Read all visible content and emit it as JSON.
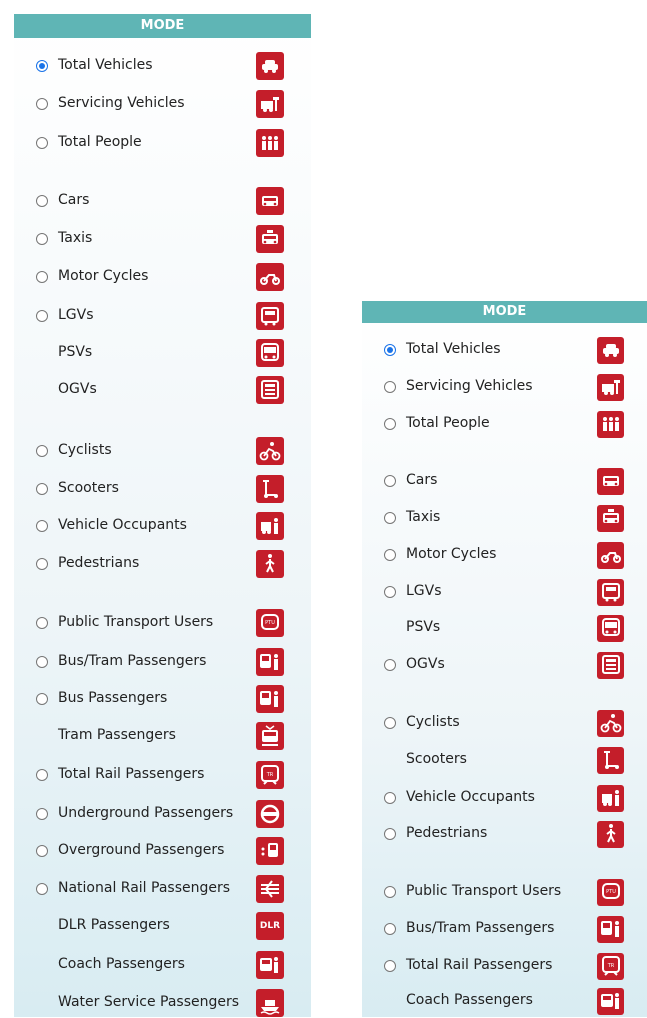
{
  "header": "MODE",
  "left_panel": {
    "items": [
      {
        "label": "Total Vehicles",
        "radio": true,
        "checked": true,
        "icon": "total-vehicles-icon"
      },
      {
        "label": "Servicing Vehicles",
        "radio": true,
        "checked": false,
        "icon": "servicing-vehicles-icon"
      },
      {
        "label": "Total People",
        "radio": true,
        "checked": false,
        "icon": "total-people-icon"
      },
      {
        "label": "Cars",
        "radio": true,
        "checked": false,
        "icon": "car-icon"
      },
      {
        "label": "Taxis",
        "radio": true,
        "checked": false,
        "icon": "taxi-icon"
      },
      {
        "label": "Motor Cycles",
        "radio": true,
        "checked": false,
        "icon": "motorcycle-icon"
      },
      {
        "label": "LGVs",
        "radio": true,
        "checked": false,
        "icon": "lgv-icon"
      },
      {
        "label": "PSVs",
        "radio": false,
        "checked": false,
        "icon": "psv-icon"
      },
      {
        "label": "OGVs",
        "radio": false,
        "checked": false,
        "icon": "ogv-icon"
      },
      {
        "label": "Cyclists",
        "radio": true,
        "checked": false,
        "icon": "cyclist-icon"
      },
      {
        "label": "Scooters",
        "radio": true,
        "checked": false,
        "icon": "scooter-icon"
      },
      {
        "label": "Vehicle Occupants",
        "radio": true,
        "checked": false,
        "icon": "vehicle-occupants-icon"
      },
      {
        "label": "Pedestrians",
        "radio": true,
        "checked": false,
        "icon": "pedestrian-icon"
      },
      {
        "label": "Public Transport Users",
        "radio": true,
        "checked": false,
        "icon": "ptu-icon"
      },
      {
        "label": "Bus/Tram Passengers",
        "radio": true,
        "checked": false,
        "icon": "bus-tram-passengers-icon"
      },
      {
        "label": "Bus Passengers",
        "radio": true,
        "checked": false,
        "icon": "bus-passengers-icon"
      },
      {
        "label": "Tram Passengers",
        "radio": false,
        "checked": false,
        "icon": "tram-passengers-icon"
      },
      {
        "label": "Total Rail Passengers",
        "radio": true,
        "checked": false,
        "icon": "total-rail-icon"
      },
      {
        "label": "Underground Passengers",
        "radio": true,
        "checked": false,
        "icon": "underground-icon"
      },
      {
        "label": "Overground Passengers",
        "radio": true,
        "checked": false,
        "icon": "overground-icon"
      },
      {
        "label": "National Rail Passengers",
        "radio": true,
        "checked": false,
        "icon": "national-rail-icon"
      },
      {
        "label": "DLR Passengers",
        "radio": false,
        "checked": false,
        "icon": "dlr-icon",
        "icon_text": "DLR"
      },
      {
        "label": "Coach Passengers",
        "radio": false,
        "checked": false,
        "icon": "coach-passengers-icon"
      },
      {
        "label": "Water Service Passengers",
        "radio": false,
        "checked": false,
        "icon": "water-service-icon"
      }
    ]
  },
  "right_panel": {
    "items": [
      {
        "label": "Total Vehicles",
        "radio": true,
        "checked": true,
        "icon": "total-vehicles-icon"
      },
      {
        "label": "Servicing Vehicles",
        "radio": true,
        "checked": false,
        "icon": "servicing-vehicles-icon"
      },
      {
        "label": "Total People",
        "radio": true,
        "checked": false,
        "icon": "total-people-icon"
      },
      {
        "label": "Cars",
        "radio": true,
        "checked": false,
        "icon": "car-icon"
      },
      {
        "label": "Taxis",
        "radio": true,
        "checked": false,
        "icon": "taxi-icon"
      },
      {
        "label": "Motor Cycles",
        "radio": true,
        "checked": false,
        "icon": "motorcycle-icon"
      },
      {
        "label": "LGVs",
        "radio": true,
        "checked": false,
        "icon": "lgv-icon"
      },
      {
        "label": "PSVs",
        "radio": false,
        "checked": false,
        "icon": "psv-icon"
      },
      {
        "label": "OGVs",
        "radio": true,
        "checked": false,
        "icon": "ogv-icon"
      },
      {
        "label": "Cyclists",
        "radio": true,
        "checked": false,
        "icon": "cyclist-icon"
      },
      {
        "label": "Scooters",
        "radio": false,
        "checked": false,
        "icon": "scooter-icon"
      },
      {
        "label": "Vehicle Occupants",
        "radio": true,
        "checked": false,
        "icon": "vehicle-occupants-icon"
      },
      {
        "label": "Pedestrians",
        "radio": true,
        "checked": false,
        "icon": "pedestrian-icon"
      },
      {
        "label": "Public Transport Users",
        "radio": true,
        "checked": false,
        "icon": "ptu-icon"
      },
      {
        "label": "Bus/Tram Passengers",
        "radio": true,
        "checked": false,
        "icon": "bus-tram-passengers-icon"
      },
      {
        "label": "Total Rail Passengers",
        "radio": true,
        "checked": false,
        "icon": "total-rail-icon"
      },
      {
        "label": "Coach Passengers",
        "radio": false,
        "checked": false,
        "icon": "coach-passengers-icon"
      }
    ]
  },
  "colors": {
    "header_bg": "#5fb5b5",
    "icon_bg": "#c41e2a",
    "radio_checked": "#1a73e8"
  }
}
